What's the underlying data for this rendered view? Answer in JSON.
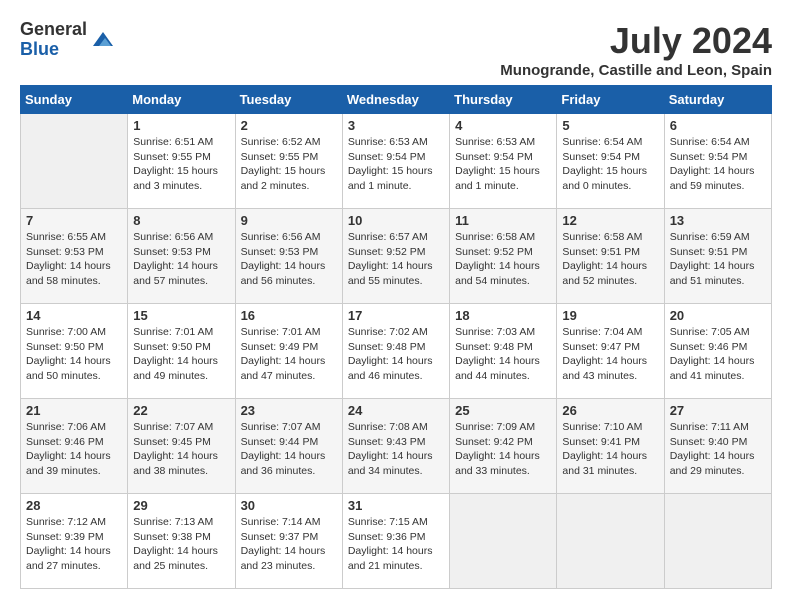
{
  "header": {
    "logo_general": "General",
    "logo_blue": "Blue",
    "month_title": "July 2024",
    "location": "Munogrande, Castille and Leon, Spain"
  },
  "days_of_week": [
    "Sunday",
    "Monday",
    "Tuesday",
    "Wednesday",
    "Thursday",
    "Friday",
    "Saturday"
  ],
  "weeks": [
    [
      {
        "day": "",
        "empty": true
      },
      {
        "day": "1",
        "sunrise": "Sunrise: 6:51 AM",
        "sunset": "Sunset: 9:55 PM",
        "daylight": "Daylight: 15 hours and 3 minutes."
      },
      {
        "day": "2",
        "sunrise": "Sunrise: 6:52 AM",
        "sunset": "Sunset: 9:55 PM",
        "daylight": "Daylight: 15 hours and 2 minutes."
      },
      {
        "day": "3",
        "sunrise": "Sunrise: 6:53 AM",
        "sunset": "Sunset: 9:54 PM",
        "daylight": "Daylight: 15 hours and 1 minute."
      },
      {
        "day": "4",
        "sunrise": "Sunrise: 6:53 AM",
        "sunset": "Sunset: 9:54 PM",
        "daylight": "Daylight: 15 hours and 1 minute."
      },
      {
        "day": "5",
        "sunrise": "Sunrise: 6:54 AM",
        "sunset": "Sunset: 9:54 PM",
        "daylight": "Daylight: 15 hours and 0 minutes."
      },
      {
        "day": "6",
        "sunrise": "Sunrise: 6:54 AM",
        "sunset": "Sunset: 9:54 PM",
        "daylight": "Daylight: 14 hours and 59 minutes."
      }
    ],
    [
      {
        "day": "7",
        "sunrise": "Sunrise: 6:55 AM",
        "sunset": "Sunset: 9:53 PM",
        "daylight": "Daylight: 14 hours and 58 minutes."
      },
      {
        "day": "8",
        "sunrise": "Sunrise: 6:56 AM",
        "sunset": "Sunset: 9:53 PM",
        "daylight": "Daylight: 14 hours and 57 minutes."
      },
      {
        "day": "9",
        "sunrise": "Sunrise: 6:56 AM",
        "sunset": "Sunset: 9:53 PM",
        "daylight": "Daylight: 14 hours and 56 minutes."
      },
      {
        "day": "10",
        "sunrise": "Sunrise: 6:57 AM",
        "sunset": "Sunset: 9:52 PM",
        "daylight": "Daylight: 14 hours and 55 minutes."
      },
      {
        "day": "11",
        "sunrise": "Sunrise: 6:58 AM",
        "sunset": "Sunset: 9:52 PM",
        "daylight": "Daylight: 14 hours and 54 minutes."
      },
      {
        "day": "12",
        "sunrise": "Sunrise: 6:58 AM",
        "sunset": "Sunset: 9:51 PM",
        "daylight": "Daylight: 14 hours and 52 minutes."
      },
      {
        "day": "13",
        "sunrise": "Sunrise: 6:59 AM",
        "sunset": "Sunset: 9:51 PM",
        "daylight": "Daylight: 14 hours and 51 minutes."
      }
    ],
    [
      {
        "day": "14",
        "sunrise": "Sunrise: 7:00 AM",
        "sunset": "Sunset: 9:50 PM",
        "daylight": "Daylight: 14 hours and 50 minutes."
      },
      {
        "day": "15",
        "sunrise": "Sunrise: 7:01 AM",
        "sunset": "Sunset: 9:50 PM",
        "daylight": "Daylight: 14 hours and 49 minutes."
      },
      {
        "day": "16",
        "sunrise": "Sunrise: 7:01 AM",
        "sunset": "Sunset: 9:49 PM",
        "daylight": "Daylight: 14 hours and 47 minutes."
      },
      {
        "day": "17",
        "sunrise": "Sunrise: 7:02 AM",
        "sunset": "Sunset: 9:48 PM",
        "daylight": "Daylight: 14 hours and 46 minutes."
      },
      {
        "day": "18",
        "sunrise": "Sunrise: 7:03 AM",
        "sunset": "Sunset: 9:48 PM",
        "daylight": "Daylight: 14 hours and 44 minutes."
      },
      {
        "day": "19",
        "sunrise": "Sunrise: 7:04 AM",
        "sunset": "Sunset: 9:47 PM",
        "daylight": "Daylight: 14 hours and 43 minutes."
      },
      {
        "day": "20",
        "sunrise": "Sunrise: 7:05 AM",
        "sunset": "Sunset: 9:46 PM",
        "daylight": "Daylight: 14 hours and 41 minutes."
      }
    ],
    [
      {
        "day": "21",
        "sunrise": "Sunrise: 7:06 AM",
        "sunset": "Sunset: 9:46 PM",
        "daylight": "Daylight: 14 hours and 39 minutes."
      },
      {
        "day": "22",
        "sunrise": "Sunrise: 7:07 AM",
        "sunset": "Sunset: 9:45 PM",
        "daylight": "Daylight: 14 hours and 38 minutes."
      },
      {
        "day": "23",
        "sunrise": "Sunrise: 7:07 AM",
        "sunset": "Sunset: 9:44 PM",
        "daylight": "Daylight: 14 hours and 36 minutes."
      },
      {
        "day": "24",
        "sunrise": "Sunrise: 7:08 AM",
        "sunset": "Sunset: 9:43 PM",
        "daylight": "Daylight: 14 hours and 34 minutes."
      },
      {
        "day": "25",
        "sunrise": "Sunrise: 7:09 AM",
        "sunset": "Sunset: 9:42 PM",
        "daylight": "Daylight: 14 hours and 33 minutes."
      },
      {
        "day": "26",
        "sunrise": "Sunrise: 7:10 AM",
        "sunset": "Sunset: 9:41 PM",
        "daylight": "Daylight: 14 hours and 31 minutes."
      },
      {
        "day": "27",
        "sunrise": "Sunrise: 7:11 AM",
        "sunset": "Sunset: 9:40 PM",
        "daylight": "Daylight: 14 hours and 29 minutes."
      }
    ],
    [
      {
        "day": "28",
        "sunrise": "Sunrise: 7:12 AM",
        "sunset": "Sunset: 9:39 PM",
        "daylight": "Daylight: 14 hours and 27 minutes."
      },
      {
        "day": "29",
        "sunrise": "Sunrise: 7:13 AM",
        "sunset": "Sunset: 9:38 PM",
        "daylight": "Daylight: 14 hours and 25 minutes."
      },
      {
        "day": "30",
        "sunrise": "Sunrise: 7:14 AM",
        "sunset": "Sunset: 9:37 PM",
        "daylight": "Daylight: 14 hours and 23 minutes."
      },
      {
        "day": "31",
        "sunrise": "Sunrise: 7:15 AM",
        "sunset": "Sunset: 9:36 PM",
        "daylight": "Daylight: 14 hours and 21 minutes."
      },
      {
        "day": "",
        "empty": true
      },
      {
        "day": "",
        "empty": true
      },
      {
        "day": "",
        "empty": true
      }
    ]
  ]
}
